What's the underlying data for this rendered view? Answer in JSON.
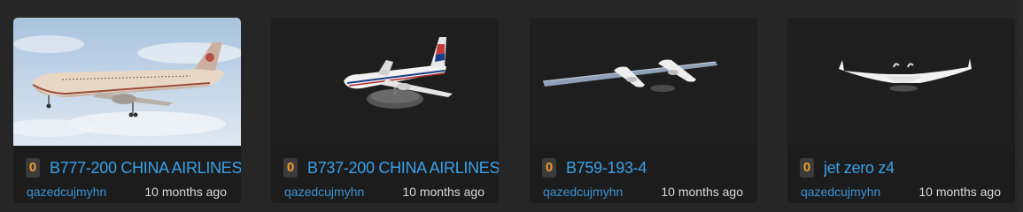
{
  "cards": [
    {
      "count": "0",
      "title": "B777-200 CHINA AIRLINES",
      "author": "qazedcujmyhn",
      "time": "10 months ago",
      "thumbnail_icon": "airplane-sky-photo"
    },
    {
      "count": "0",
      "title": "B737-200 CHINA AIRLINES",
      "author": "qazedcujmyhn",
      "time": "10 months ago",
      "thumbnail_icon": "airplane-on-stand"
    },
    {
      "count": "0",
      "title": "B759-193-4",
      "author": "qazedcujmyhn",
      "time": "10 months ago",
      "thumbnail_icon": "long-wing-aircraft"
    },
    {
      "count": "0",
      "title": "jet zero z4",
      "author": "qazedcujmyhn",
      "time": "10 months ago",
      "thumbnail_icon": "blended-wing-aircraft"
    }
  ],
  "colors": {
    "background": "#262626",
    "card": "#1b1b1b",
    "title": "#3aa0e8",
    "badge_text": "#f29a2e"
  }
}
